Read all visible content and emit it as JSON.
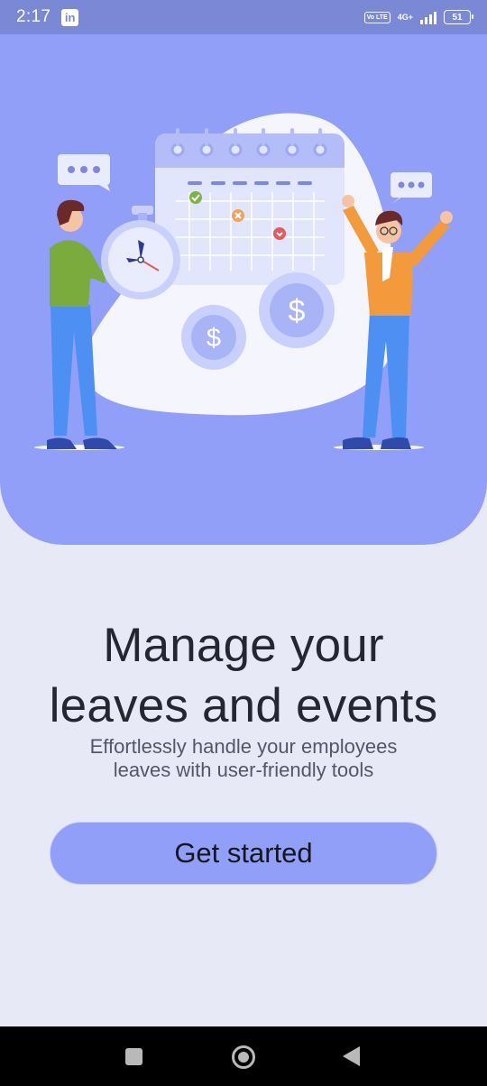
{
  "status_bar": {
    "time": "2:17",
    "app_icon": "linkedin-icon",
    "volte_label": "Vo LTE",
    "network_label": "4G+",
    "battery_level": "51"
  },
  "hero": {
    "illustration": "calendar-clock-people-illustration",
    "color": "#919ff9"
  },
  "onboarding": {
    "title_line1": "Manage your",
    "title_line2": "leaves and events",
    "subtitle_line1": "Effortlessly handle your employees",
    "subtitle_line2": "leaves with user-friendly tools",
    "cta_label": "Get started"
  },
  "nav_bar": {
    "recent_icon": "square-icon",
    "home_icon": "circle-home-icon",
    "back_icon": "triangle-back-icon"
  }
}
